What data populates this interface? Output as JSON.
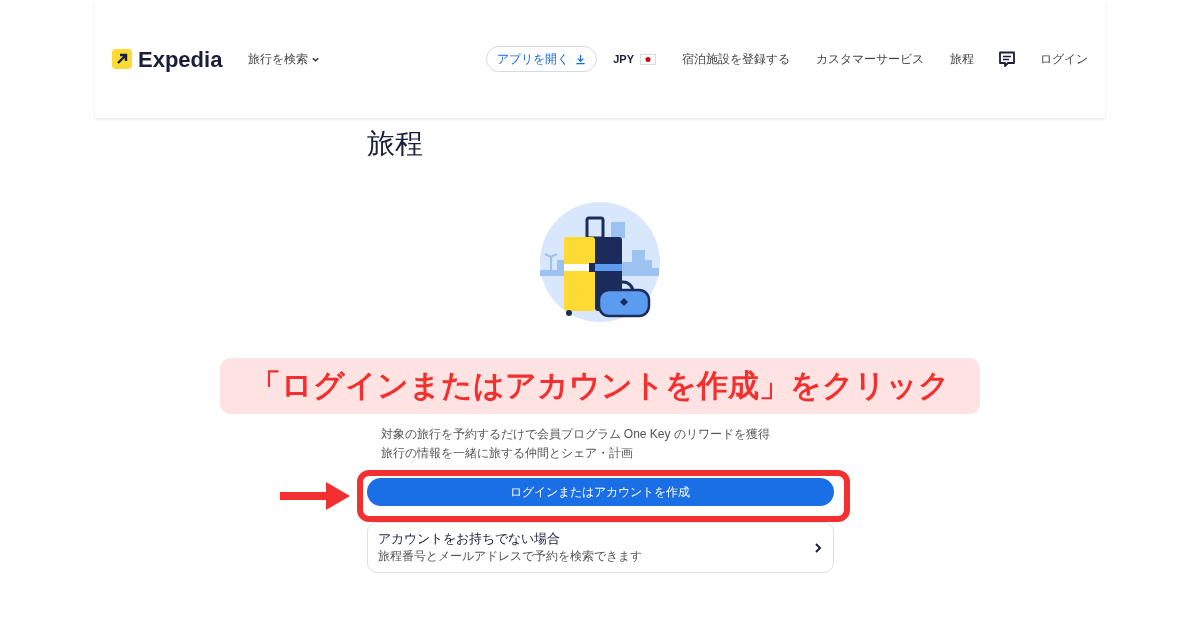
{
  "header": {
    "logo": "Expedia",
    "trip_menu": "旅行を検索",
    "app_button": "アプリを開く",
    "currency": "JPY",
    "links": [
      "宿泊施設を登録する",
      "カスタマーサービス",
      "旅程"
    ],
    "login": "ログイン"
  },
  "page": {
    "title": "旅程",
    "benefits": [
      "対象の旅行を予約するだけで会員プログラム One Key のリワードを獲得",
      "旅行の情報を一緒に旅する仲間とシェア・計画"
    ],
    "login_button": "ログインまたはアカウントを作成",
    "guest_card": {
      "title": "アカウントをお持ちでない場合",
      "subtitle": "旅程番号とメールアドレスで予約を検索できます"
    }
  },
  "annotation": {
    "caption": "「ログインまたはアカウントを作成」をクリック"
  }
}
